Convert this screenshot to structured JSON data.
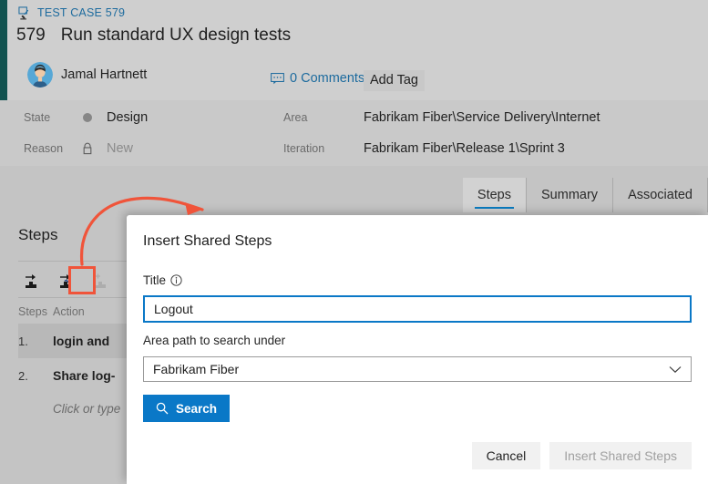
{
  "work_item": {
    "breadcrumb": "TEST CASE 579",
    "breadcrumb_icon": "test-case-icon",
    "id": "579",
    "title": "Run standard UX design tests",
    "assigned_to": "Jamal Hartnett",
    "avatar_icon": "avatar",
    "comments_label": "0 Comments",
    "comments_icon": "comment-bubble-icon",
    "add_tag_label": "Add Tag",
    "accent_color": "#11524f",
    "link_color": "#1d6b9e"
  },
  "fields": {
    "state": {
      "label": "State",
      "value": "Design",
      "icon": "state-dot-icon"
    },
    "reason": {
      "label": "Reason",
      "value": "New",
      "icon": "lock-icon"
    },
    "area": {
      "label": "Area",
      "value": "Fabrikam Fiber\\Service Delivery\\Internet"
    },
    "iteration": {
      "label": "Iteration",
      "value": "Fabrikam Fiber\\Release 1\\Sprint 3"
    }
  },
  "tabs": [
    {
      "label": "Steps",
      "active": true
    },
    {
      "label": "Summary",
      "active": false
    },
    {
      "label": "Associated",
      "active": false
    }
  ],
  "tabs_active_underline_color": "#0a7bc0",
  "steps_panel": {
    "heading": "Steps",
    "toolbar": [
      {
        "name": "insert-step-button",
        "icon": "insert-step-icon",
        "enabled": true,
        "highlighted": false
      },
      {
        "name": "insert-shared-steps-button",
        "icon": "insert-shared-steps-icon",
        "enabled": true,
        "highlighted": true
      },
      {
        "name": "add-step-button",
        "icon": "add-step-icon",
        "enabled": false,
        "highlighted": false
      }
    ],
    "columns": [
      "Steps",
      "Action"
    ],
    "rows": [
      {
        "num": "1.",
        "action": "login and",
        "selected": true
      },
      {
        "num": "2.",
        "action": "Share log-",
        "selected": false
      }
    ],
    "placeholder_row": "Click or type"
  },
  "dialog": {
    "title": "Insert Shared Steps",
    "title_field": {
      "label": "Title",
      "info_icon": "info-icon",
      "value": "Logout",
      "placeholder": "",
      "focused": true,
      "focus_color": "#0a78c7"
    },
    "area_field": {
      "label": "Area path to search under",
      "value": "Fabrikam Fiber",
      "chevron_icon": "chevron-down-icon"
    },
    "search_button": {
      "label": "Search",
      "icon": "search-icon",
      "color": "#0a78c7"
    },
    "cancel_button": {
      "label": "Cancel",
      "enabled": true
    },
    "submit_button": {
      "label": "Insert Shared Steps",
      "enabled": false
    }
  },
  "annotation": {
    "highlight_color": "#f0543a",
    "arrow": "curved-arrow-from-toolbar-to-dialog"
  }
}
